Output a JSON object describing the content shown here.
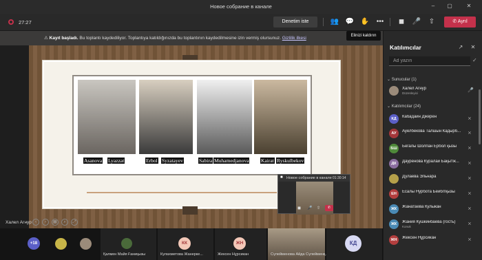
{
  "window": {
    "title": "Новое собрание в канале"
  },
  "toolbar": {
    "timer": "27:27",
    "review_button": "Denetim iste",
    "leave_label": "Ayrıl",
    "icons": [
      "participants-icon",
      "chat-icon",
      "raise-hand-icon",
      "more-icon",
      "camera-icon",
      "mic-icon",
      "share-icon"
    ]
  },
  "banner": {
    "bold": "Kayıt başladı.",
    "text": "Bu toplantı kaydediliyor. Toplantıya katıldığınızda bu toplantının kaydedilmesine izin vermiş olursunuz.",
    "link": "Gizlilik ilkesi"
  },
  "tooltip": "Elinizi kaldırın",
  "slide": {
    "captions": [
      "Asanova",
      "Lyazzat",
      "Erbol",
      "Syzatayev",
      "Sabira",
      "Muhamedjanova",
      "Kairat",
      "Ryskulbekov"
    ]
  },
  "presenter": {
    "name": "Халел Агнур"
  },
  "pip": {
    "title": "Новое собрание в канале",
    "time": "01:30:14"
  },
  "gallery": {
    "overflow": "+18",
    "tiles": [
      {
        "name": "Қалмен Майя Ғаниқызы",
        "initials": ""
      },
      {
        "name": "Кулахметова Жанерке...",
        "initials": "КК"
      },
      {
        "name": "Жексен Нұрсикан",
        "initials": "ЖН"
      },
      {
        "name": "Сүлейменова Айда Сүлейменқ...",
        "initials": ""
      },
      {
        "name": "",
        "initials": "КД"
      }
    ]
  },
  "panel": {
    "title": "Katılımcılar",
    "search_placeholder": "Ad yazın",
    "presenters_header": "Sunucular (1)",
    "presenter": {
      "name": "Халел Агнур",
      "role": "Düzenleyici"
    },
    "attendees_header": "Katılımcılar (24)",
    "attendees": [
      {
        "name": "Кабадайн Джерен",
        "initials": "КД",
        "color": "#5b5fc7"
      },
      {
        "name": "Ауелбекова Талшын Кадырб...",
        "initials": "АУ",
        "color": "#a4373a"
      },
      {
        "name": "Бегалы Шолпан Ербол қызы",
        "initials": "БШ",
        "color": "#4f8a3a"
      },
      {
        "name": "Дауренова Куралай Бақытж...",
        "initials": "ДК",
        "color": "#8a6d9f"
      },
      {
        "name": "Дулаева Эльнара",
        "initials": "",
        "color": "#b5a04a"
      },
      {
        "name": "Есалы Нурбота Бейбітқызы",
        "initials": "ЕН",
        "color": "#b33e3e"
      },
      {
        "name": "Жанатаева Кульжан",
        "initials": "ЖК",
        "color": "#4a8ab5"
      },
      {
        "name": "Жания Кушкинбаева (гость)",
        "initials": "ЖК",
        "color": "#4a8ab5",
        "sub": "Konuk"
      },
      {
        "name": "Жексен Нұрсикан",
        "initials": "ЖН",
        "color": "#b33e3e"
      }
    ]
  }
}
